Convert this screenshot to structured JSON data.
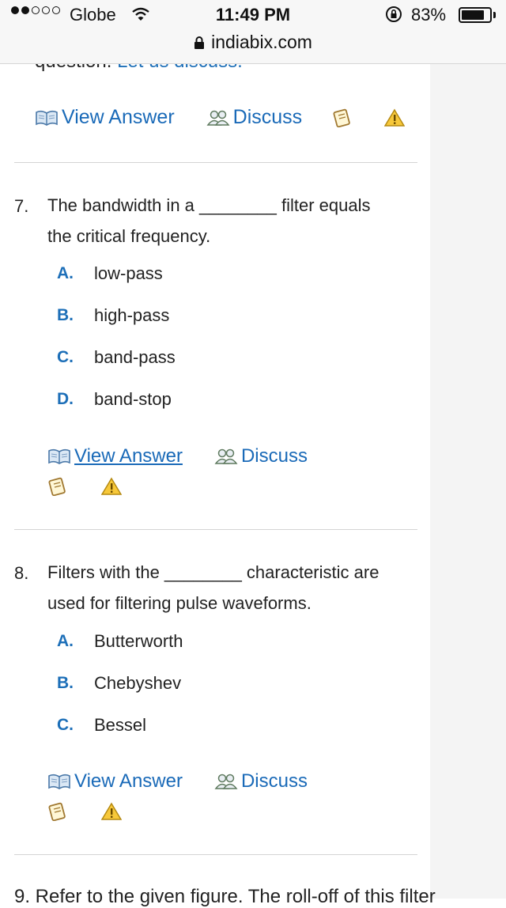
{
  "status_bar": {
    "carrier": "Globe",
    "time": "11:49 PM",
    "battery_percent": "83%",
    "battery_level": 0.83,
    "signal_bars_filled": 2,
    "signal_bars_total": 5
  },
  "url_bar": {
    "domain": "indiabix.com"
  },
  "cutoff_top": {
    "text": "question.",
    "link": "Let us discuss."
  },
  "actions_labels": {
    "view_answer": "View Answer",
    "discuss": "Discuss"
  },
  "questions": [
    {
      "number": "7.",
      "line1": "The bandwidth in a ________ filter equals",
      "line2": "the critical frequency.",
      "options": [
        {
          "letter": "A.",
          "text": "low-pass"
        },
        {
          "letter": "B.",
          "text": "high-pass"
        },
        {
          "letter": "C.",
          "text": "band-pass"
        },
        {
          "letter": "D.",
          "text": "band-stop"
        }
      ]
    },
    {
      "number": "8.",
      "line1": "Filters with the ________ characteristic are",
      "line2": "used for filtering pulse waveforms.",
      "options": [
        {
          "letter": "A.",
          "text": "Butterworth"
        },
        {
          "letter": "B.",
          "text": "Chebyshev"
        },
        {
          "letter": "C.",
          "text": "Bessel"
        }
      ]
    }
  ],
  "cutoff_bottom": {
    "text": "9. Refer to the given figure. The roll-off of this filter"
  },
  "colors": {
    "link": "#1a6ab8",
    "option_letter": "#1d6fb8",
    "gutter": "#f4f4f4"
  },
  "icons": [
    "book-icon",
    "users-icon",
    "notepad-icon",
    "warning-icon",
    "lock-icon",
    "wifi-icon",
    "rotation-lock-icon"
  ]
}
